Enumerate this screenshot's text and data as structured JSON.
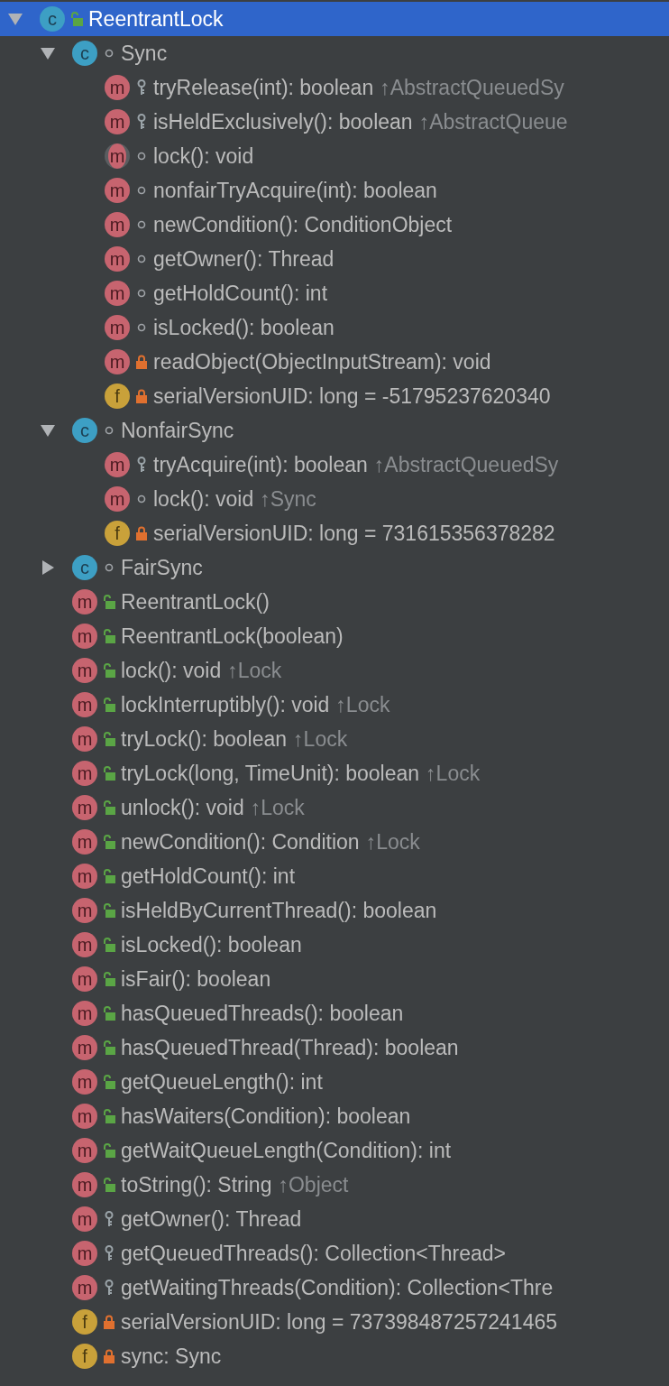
{
  "tree": [
    {
      "kind": "class",
      "badge": "c",
      "access": {
        "kind": "public"
      },
      "name": "ReentrantLock",
      "selected": true,
      "expanded": true,
      "children": [
        {
          "kind": "class",
          "badge": "c",
          "access": {
            "kind": "package"
          },
          "name": "Sync",
          "selected": false,
          "expanded": true,
          "children": [
            {
              "kind": "method",
              "badge": "m",
              "access": {
                "kind": "protected"
              },
              "name": "tryRelease(int): boolean",
              "inherited": "↑AbstractQueuedSy",
              "selected": false
            },
            {
              "kind": "method",
              "badge": "m",
              "access": {
                "kind": "protected"
              },
              "name": "isHeldExclusively(): boolean",
              "inherited": "↑AbstractQueue",
              "selected": false
            },
            {
              "kind": "abstract_method",
              "badge": "m",
              "access": {
                "kind": "package"
              },
              "name": "lock(): void",
              "selected": false
            },
            {
              "kind": "method",
              "badge": "m",
              "access": {
                "kind": "package"
              },
              "name": "nonfairTryAcquire(int): boolean",
              "selected": false
            },
            {
              "kind": "method",
              "badge": "m",
              "access": {
                "kind": "package"
              },
              "name": "newCondition(): ConditionObject",
              "selected": false
            },
            {
              "kind": "method",
              "badge": "m",
              "access": {
                "kind": "package"
              },
              "name": "getOwner(): Thread",
              "selected": false
            },
            {
              "kind": "method",
              "badge": "m",
              "access": {
                "kind": "package"
              },
              "name": "getHoldCount(): int",
              "selected": false
            },
            {
              "kind": "method",
              "badge": "m",
              "access": {
                "kind": "package"
              },
              "name": "isLocked(): boolean",
              "selected": false
            },
            {
              "kind": "method",
              "badge": "m",
              "access": {
                "kind": "private"
              },
              "name": "readObject(ObjectInputStream): void",
              "selected": false
            },
            {
              "kind": "field",
              "badge": "f",
              "access": {
                "kind": "private"
              },
              "name": "serialVersionUID: long = -51795237620340",
              "selected": false
            }
          ]
        },
        {
          "kind": "class",
          "badge": "c",
          "access": {
            "kind": "package"
          },
          "name": "NonfairSync",
          "selected": false,
          "expanded": true,
          "children": [
            {
              "kind": "method",
              "badge": "m",
              "access": {
                "kind": "protected"
              },
              "name": "tryAcquire(int): boolean",
              "inherited": "↑AbstractQueuedSy",
              "selected": false
            },
            {
              "kind": "method",
              "badge": "m",
              "access": {
                "kind": "package"
              },
              "name": "lock(): void",
              "inherited": "↑Sync",
              "selected": false
            },
            {
              "kind": "field",
              "badge": "f",
              "access": {
                "kind": "private"
              },
              "name": "serialVersionUID: long = 731615356378282",
              "selected": false
            }
          ]
        },
        {
          "kind": "class",
          "badge": "c",
          "access": {
            "kind": "package"
          },
          "name": "FairSync",
          "selected": false,
          "expanded": false
        },
        {
          "kind": "method",
          "badge": "m",
          "access": {
            "kind": "public"
          },
          "name": "ReentrantLock()",
          "selected": false
        },
        {
          "kind": "method",
          "badge": "m",
          "access": {
            "kind": "public"
          },
          "name": "ReentrantLock(boolean)",
          "selected": false
        },
        {
          "kind": "method",
          "badge": "m",
          "access": {
            "kind": "public"
          },
          "name": "lock(): void",
          "inherited": "↑Lock",
          "selected": false
        },
        {
          "kind": "method",
          "badge": "m",
          "access": {
            "kind": "public"
          },
          "name": "lockInterruptibly(): void",
          "inherited": "↑Lock",
          "selected": false
        },
        {
          "kind": "method",
          "badge": "m",
          "access": {
            "kind": "public"
          },
          "name": "tryLock(): boolean",
          "inherited": "↑Lock",
          "selected": false
        },
        {
          "kind": "method",
          "badge": "m",
          "access": {
            "kind": "public"
          },
          "name": "tryLock(long, TimeUnit): boolean",
          "inherited": "↑Lock",
          "selected": false
        },
        {
          "kind": "method",
          "badge": "m",
          "access": {
            "kind": "public"
          },
          "name": "unlock(): void",
          "inherited": "↑Lock",
          "selected": false
        },
        {
          "kind": "method",
          "badge": "m",
          "access": {
            "kind": "public"
          },
          "name": "newCondition(): Condition",
          "inherited": "↑Lock",
          "selected": false
        },
        {
          "kind": "method",
          "badge": "m",
          "access": {
            "kind": "public"
          },
          "name": "getHoldCount(): int",
          "selected": false
        },
        {
          "kind": "method",
          "badge": "m",
          "access": {
            "kind": "public"
          },
          "name": "isHeldByCurrentThread(): boolean",
          "selected": false
        },
        {
          "kind": "method",
          "badge": "m",
          "access": {
            "kind": "public"
          },
          "name": "isLocked(): boolean",
          "selected": false
        },
        {
          "kind": "method",
          "badge": "m",
          "access": {
            "kind": "public"
          },
          "name": "isFair(): boolean",
          "selected": false
        },
        {
          "kind": "method",
          "badge": "m",
          "access": {
            "kind": "public"
          },
          "name": "hasQueuedThreads(): boolean",
          "selected": false
        },
        {
          "kind": "method",
          "badge": "m",
          "access": {
            "kind": "public"
          },
          "name": "hasQueuedThread(Thread): boolean",
          "selected": false
        },
        {
          "kind": "method",
          "badge": "m",
          "access": {
            "kind": "public"
          },
          "name": "getQueueLength(): int",
          "selected": false
        },
        {
          "kind": "method",
          "badge": "m",
          "access": {
            "kind": "public"
          },
          "name": "hasWaiters(Condition): boolean",
          "selected": false
        },
        {
          "kind": "method",
          "badge": "m",
          "access": {
            "kind": "public"
          },
          "name": "getWaitQueueLength(Condition): int",
          "selected": false
        },
        {
          "kind": "method",
          "badge": "m",
          "access": {
            "kind": "public"
          },
          "name": "toString(): String",
          "inherited": "↑Object",
          "selected": false
        },
        {
          "kind": "method",
          "badge": "m",
          "access": {
            "kind": "protected"
          },
          "name": "getOwner(): Thread",
          "selected": false
        },
        {
          "kind": "method",
          "badge": "m",
          "access": {
            "kind": "protected"
          },
          "name": "getQueuedThreads(): Collection<Thread>",
          "selected": false
        },
        {
          "kind": "method",
          "badge": "m",
          "access": {
            "kind": "protected"
          },
          "name": "getWaitingThreads(Condition): Collection<Thre",
          "selected": false
        },
        {
          "kind": "field",
          "badge": "f",
          "access": {
            "kind": "private"
          },
          "name": "serialVersionUID: long = 737398487257241465",
          "selected": false
        },
        {
          "kind": "field",
          "badge": "f",
          "access": {
            "kind": "private"
          },
          "name": "sync: Sync",
          "selected": false
        }
      ]
    }
  ]
}
